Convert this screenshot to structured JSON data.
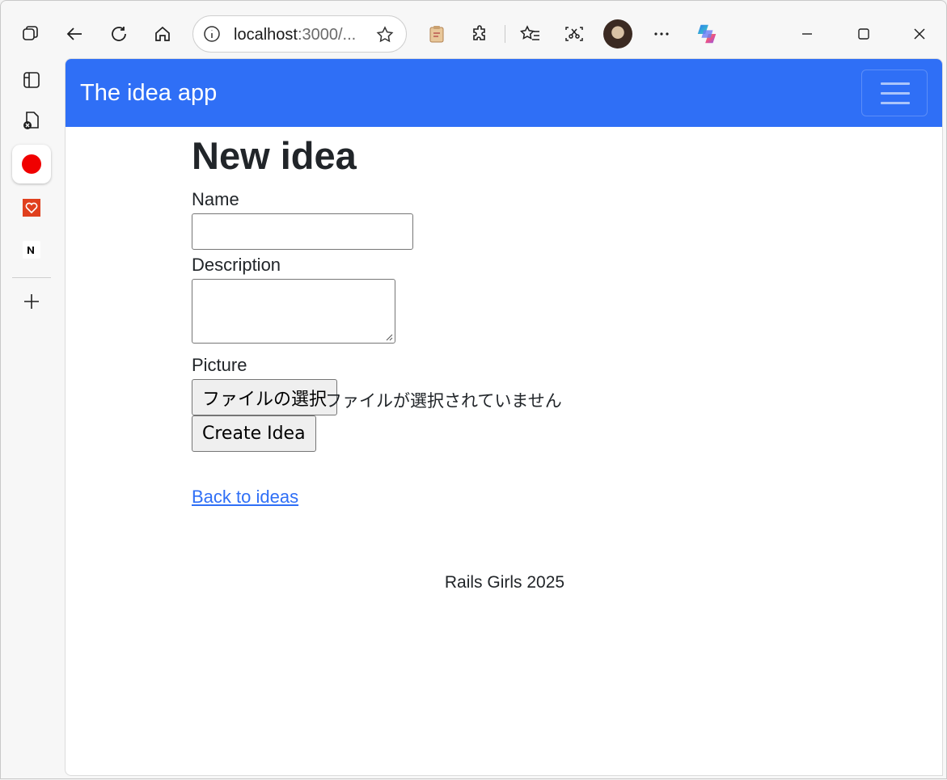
{
  "browser": {
    "url_host": "localhost",
    "url_rest": ":3000/...",
    "tabs_icon": "tab-actions-icon",
    "back_icon": "back-arrow-icon",
    "reload_icon": "reload-icon",
    "home_icon": "home-icon",
    "info_icon": "site-info-icon",
    "favorite_icon": "star-icon",
    "toolbar_icons": [
      "clipboard-icon",
      "extensions-icon",
      "favorites-icon",
      "screenshot-icon",
      "profile-avatar",
      "more-icon",
      "copilot-icon"
    ],
    "window_controls": [
      "minimize-icon",
      "maximize-icon",
      "close-icon"
    ]
  },
  "sidebar": {
    "items": [
      "vertical-tabs-icon",
      "collections-icon",
      "recording-icon",
      "health-icon",
      "notion-icon",
      "add-icon"
    ]
  },
  "app": {
    "brand": "The idea app",
    "toggler_icon": "hamburger-icon",
    "heading": "New idea",
    "form": {
      "name_label": "Name",
      "name_value": "",
      "description_label": "Description",
      "description_value": "",
      "picture_label": "Picture",
      "file_button": "ファイルの選択",
      "file_status": "ファイルが選択されていません",
      "submit": "Create Idea"
    },
    "back_link": "Back to ideas",
    "footer": "Rails Girls 2025"
  },
  "colors": {
    "navbar": "#2f6ff6",
    "link": "#2f6ff6",
    "text": "#212529"
  }
}
